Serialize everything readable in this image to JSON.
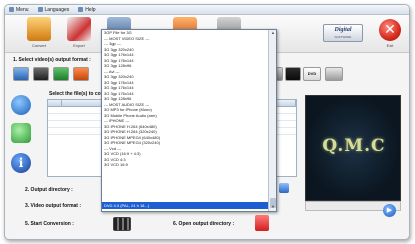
{
  "menu": {
    "items": [
      "Menu",
      "Languages",
      "Help"
    ]
  },
  "toolbar": {
    "buttons": [
      {
        "label": "Convert",
        "icon": "convert-icon"
      },
      {
        "label": "Export",
        "icon": "export-icon"
      },
      {
        "label": "Video",
        "icon": "video-icon"
      },
      {
        "label": "Audio",
        "icon": "audio-icon"
      },
      {
        "label": "Settings",
        "icon": "settings-icon"
      }
    ],
    "logo": "Digital",
    "logo_sub": "SOFTWARE",
    "exit_label": "Exit"
  },
  "steps": {
    "s1": "1.  Select video(s) output format :",
    "s_list": "Select the file(s) to convert :",
    "s2": "2.  Output directory :",
    "s3": "3.  Video output format :",
    "s4": "5.  Start Conversion :",
    "s5": "6.  Open output directory :"
  },
  "format_icons": {
    "dvd_label": "DVD"
  },
  "preview": {
    "text": "Q.M.C"
  },
  "dropdown": {
    "options": [
      "3GP File for 3G",
      "--- MOST VIDEO SIZE ---",
      "--- 3gp ---",
      "3G 3gp 320x240",
      "3G 3gp 176x144",
      "3G 3gp 176x144",
      "3G 3gp 128x96",
      "--- Avi ---",
      "3G 3gp 320x240",
      "3G 3gp 176x144",
      "3G 3gp 176x144",
      "3G 3gp 176x144",
      "3G 3gp 128x96",
      "--- MOST AUDIO SIZE ---",
      "3G MP3 for iPhone (Mono)",
      "3G Mobile Phone Audio (arm)",
      "--- iPHONE ---",
      "3G IPHONE H.264 (640x480)",
      "3G IPHONE H.264 (320x240)",
      "3G IPHONE MPEG4 (640x480)",
      "3G IPHONE MPEG4 (320x240)",
      "--- Vcd ---",
      "3G VCD (16:9 + 4:3)",
      "3G VCD 4:3",
      "3G VCD 16:9"
    ],
    "selected": "DVD 4:3 (PAL, 24 h 18...)"
  }
}
